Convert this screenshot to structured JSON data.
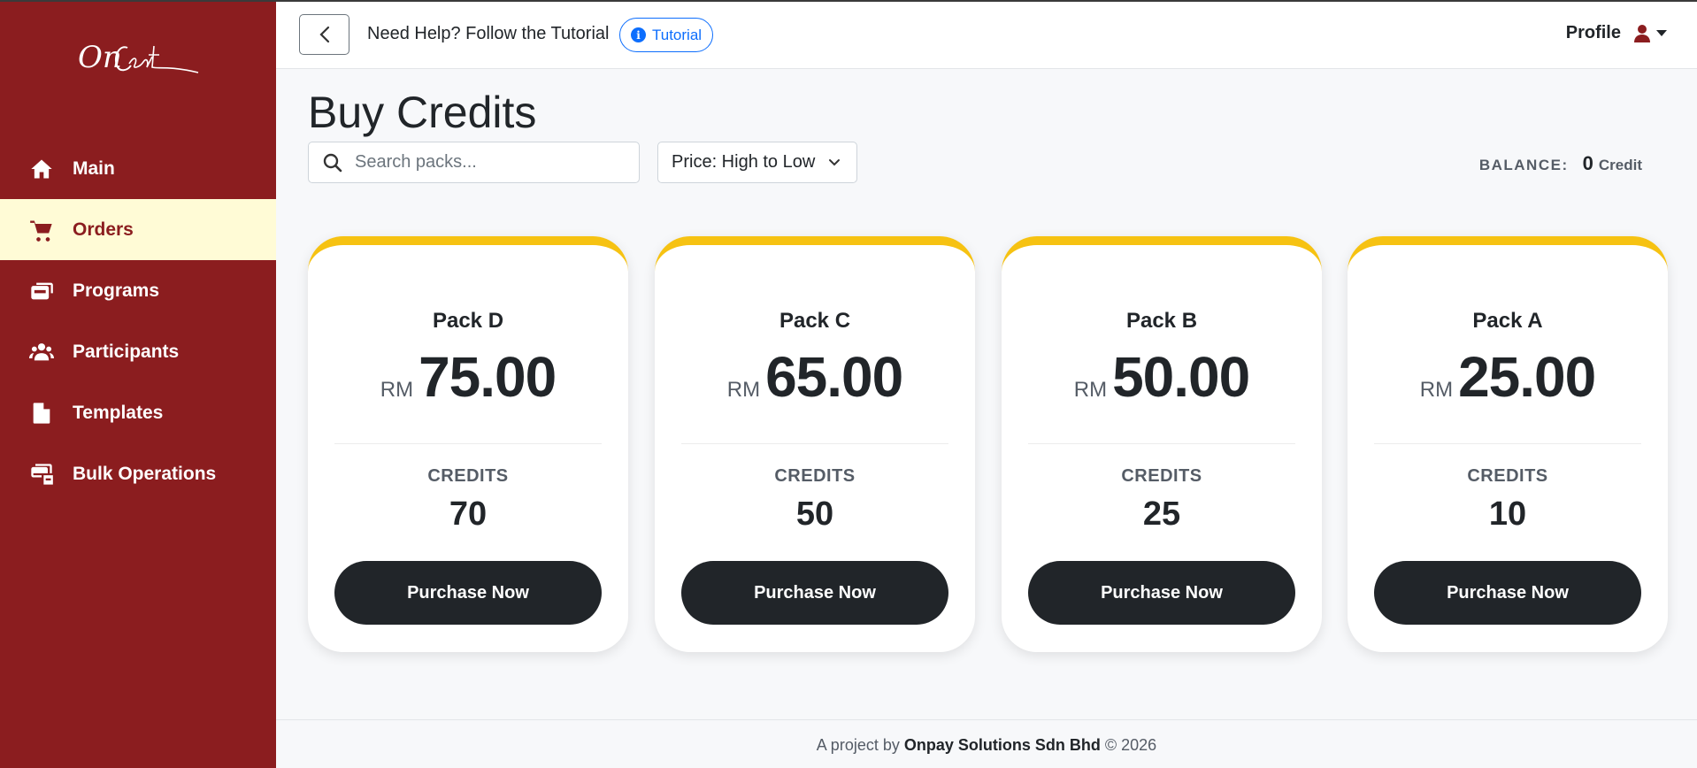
{
  "brand": {
    "logo_text": "OnCert"
  },
  "sidebar": {
    "items": [
      {
        "label": "Main",
        "icon": "home-icon",
        "active": false
      },
      {
        "label": "Orders",
        "icon": "cart-icon",
        "active": true
      },
      {
        "label": "Programs",
        "icon": "programs-icon",
        "active": false
      },
      {
        "label": "Participants",
        "icon": "users-icon",
        "active": false
      },
      {
        "label": "Templates",
        "icon": "file-icon",
        "active": false
      },
      {
        "label": "Bulk Operations",
        "icon": "bulk-icon",
        "active": false
      }
    ]
  },
  "header": {
    "help_text": "Need Help? Follow the Tutorial",
    "tutorial_label": "Tutorial",
    "profile_label": "Profile"
  },
  "main": {
    "title": "Buy Credits",
    "search_placeholder": "Search packs...",
    "sort_selected": "Price: High to Low",
    "balance_label": "BALANCE:",
    "balance_value": "0",
    "balance_unit": "Credit",
    "credits_label": "CREDITS",
    "purchase_label": "Purchase Now",
    "packs": [
      {
        "name": "Pack D",
        "currency": "RM",
        "price": "75.00",
        "credits": "70"
      },
      {
        "name": "Pack C",
        "currency": "RM",
        "price": "65.00",
        "credits": "50"
      },
      {
        "name": "Pack B",
        "currency": "RM",
        "price": "50.00",
        "credits": "25"
      },
      {
        "name": "Pack A",
        "currency": "RM",
        "price": "25.00",
        "credits": "10"
      }
    ]
  },
  "footer": {
    "prefix": "A project by",
    "company": "Onpay Solutions Sdn Bhd",
    "suffix": "© 2026"
  },
  "colors": {
    "sidebar_bg": "#8b1d1f",
    "active_item_bg": "#fffbd6",
    "card_accent": "#f6c212",
    "button_bg": "#212529",
    "tutorial_blue": "#0d6efd"
  }
}
